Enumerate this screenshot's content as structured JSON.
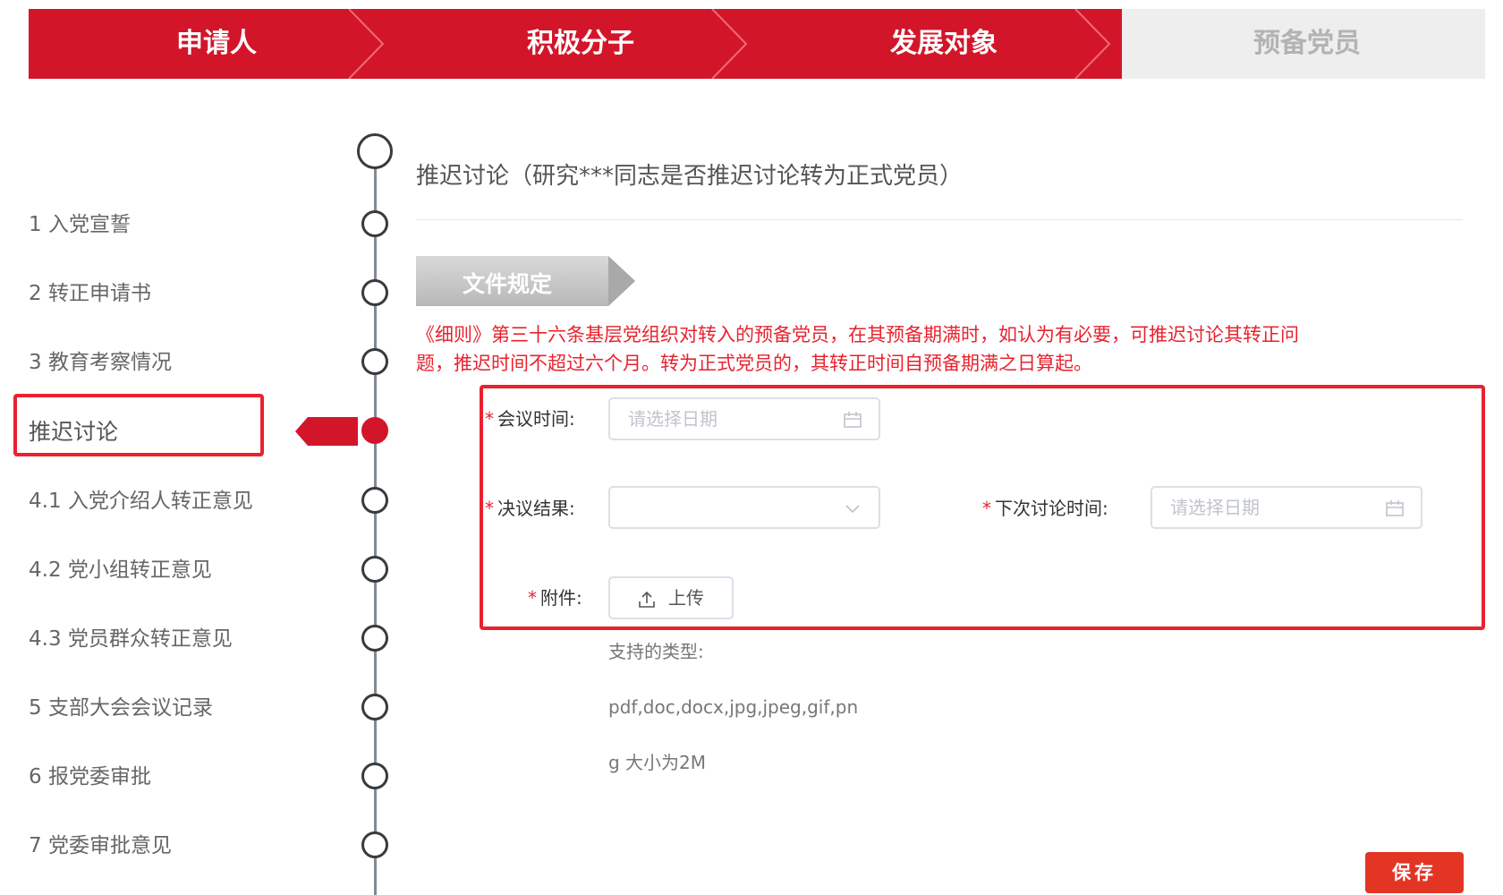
{
  "stepper": {
    "steps": [
      {
        "label": "申请人",
        "state": "done"
      },
      {
        "label": "积极分子",
        "state": "done"
      },
      {
        "label": "发展对象",
        "state": "done"
      },
      {
        "label": "预备党员",
        "state": "pending"
      }
    ]
  },
  "nav": {
    "items": [
      {
        "label": "1 入党宣誓"
      },
      {
        "label": "2 转正申请书"
      },
      {
        "label": "3 教育考察情况"
      },
      {
        "label": "推迟讨论",
        "current": true
      },
      {
        "label": "4.1 入党介绍人转正意见"
      },
      {
        "label": "4.2 党小组转正意见"
      },
      {
        "label": "4.3 党员群众转正意见"
      },
      {
        "label": "5 支部大会会议记录"
      },
      {
        "label": "6 报党委审批"
      },
      {
        "label": "7 党委审批意见"
      }
    ]
  },
  "section": {
    "title": "推迟讨论（研究***同志是否推迟讨论转为正式党员）",
    "doc_tag": "文件规定",
    "regulation_line1": "《细则》第三十六条基层党组织对转入的预备党员，在其预备期满时，如认为有必要，可推迟讨论其转正问",
    "regulation_line2": "题，推迟时间不超过六个月。转为正式党员的，其转正时间自预备期满之日算起。"
  },
  "form": {
    "meeting_time": {
      "label": "会议时间:",
      "placeholder": "请选择日期",
      "icon": "calendar-icon"
    },
    "resolution": {
      "label": "决议结果:",
      "value": "",
      "icon": "chevron-down-icon"
    },
    "next_discussion": {
      "label": "下次讨论时间:",
      "placeholder": "请选择日期",
      "icon": "calendar-icon"
    },
    "attachment": {
      "label": "附件:",
      "button": "上传",
      "icon": "upload-icon"
    },
    "hint_line1": "支持的类型:",
    "hint_line2": "pdf,doc,docx,jpg,jpeg,gif,pn",
    "hint_line3": "g 大小为2M",
    "required_mark": "*"
  },
  "actions": {
    "save": "保存"
  },
  "colors": {
    "primary_red": "#d3152a",
    "alert_red": "#e8232f",
    "save_red": "#e33524",
    "inactive_grey": "#eeeeee"
  }
}
